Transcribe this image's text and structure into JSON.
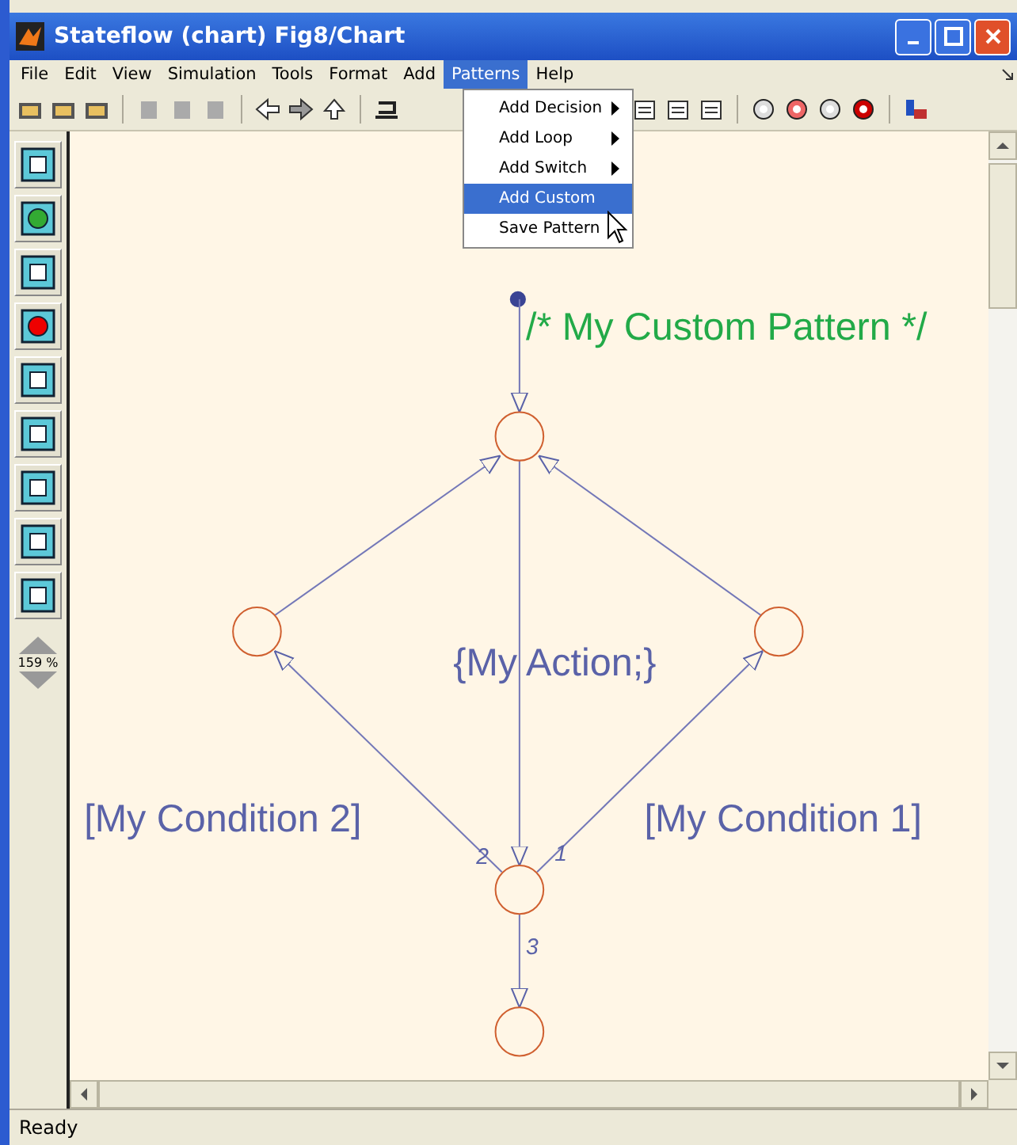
{
  "window": {
    "title": "Stateflow (chart) Fig8/Chart"
  },
  "menu_bar": [
    {
      "label": "File",
      "selected": false
    },
    {
      "label": "Edit",
      "selected": false
    },
    {
      "label": "View",
      "selected": false
    },
    {
      "label": "Simulation",
      "selected": false
    },
    {
      "label": "Tools",
      "selected": false
    },
    {
      "label": "Format",
      "selected": false
    },
    {
      "label": "Add",
      "selected": false
    },
    {
      "label": "Patterns",
      "selected": true
    },
    {
      "label": "Help",
      "selected": false
    }
  ],
  "patterns_menu": [
    {
      "label": "Add Decision",
      "submenu": true,
      "selected": false
    },
    {
      "label": "Add Loop",
      "submenu": true,
      "selected": false
    },
    {
      "label": "Add Switch",
      "submenu": true,
      "selected": false
    },
    {
      "label": "Add Custom",
      "submenu": false,
      "selected": true
    },
    {
      "label": "Save Pattern",
      "submenu": false,
      "selected": false
    }
  ],
  "palette": {
    "zoom": "159 %"
  },
  "chart": {
    "comment": "/* My Custom Pattern */",
    "action": "{My Action;}",
    "conditions": [
      "[My Condition 2]",
      "[My Condition 1]"
    ],
    "transition_orders": [
      "2",
      "1",
      "3"
    ]
  },
  "status_bar": "Ready"
}
